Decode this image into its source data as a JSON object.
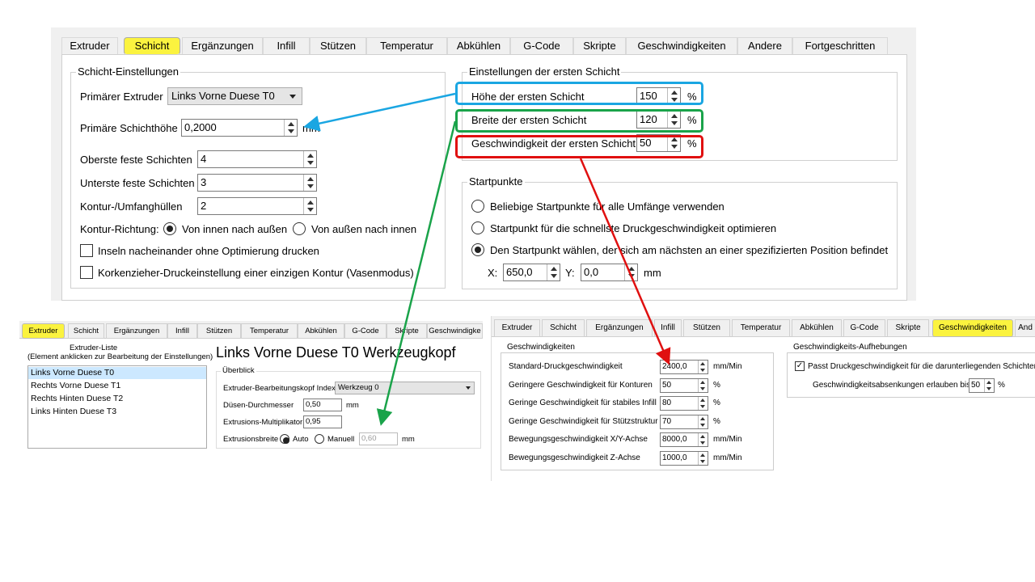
{
  "main": {
    "tabs": [
      "Extruder",
      "Schicht",
      "Ergänzungen",
      "Infill",
      "Stützen",
      "Temperatur",
      "Abkühlen",
      "G-Code",
      "Skripte",
      "Geschwindigkeiten",
      "Andere",
      "Fortgeschritten"
    ],
    "active_tab": "Schicht",
    "layer_settings": {
      "title": "Schicht-Einstellungen",
      "primary_extruder_label": "Primärer Extruder",
      "primary_extruder_value": "Links Vorne Duese T0",
      "layer_height_label": "Primäre Schichthöhe",
      "layer_height_value": "0,2000",
      "layer_height_unit": "mm",
      "top_solid_label": "Oberste feste Schichten",
      "top_solid_value": "4",
      "bottom_solid_label": "Unterste feste Schichten",
      "bottom_solid_value": "3",
      "perimeters_label": "Kontur-/Umfanghüllen",
      "perimeters_value": "2",
      "direction_label": "Kontur-Richtung:",
      "direction_inside_out": "Von innen nach außen",
      "direction_outside_in": "Von außen nach innen",
      "islands_label": "Inseln nacheinander ohne Optimierung drucken",
      "vase_label": "Korkenzieher-Druckeinstellung einer einzigen Kontur (Vasenmodus)"
    },
    "first_layer": {
      "title": "Einstellungen der ersten Schicht",
      "height_label": "Höhe der ersten Schicht",
      "height_value": "150",
      "width_label": "Breite der ersten Schicht",
      "width_value": "120",
      "speed_label": "Geschwindigkeit der ersten Schicht",
      "speed_value": "50",
      "percent": "%"
    },
    "start_points": {
      "title": "Startpunkte",
      "option1": "Beliebige Startpunkte für alle Umfänge verwenden",
      "option2": "Startpunkt für die schnellste Druckgeschwindigkeit optimieren",
      "option3": "Den Startpunkt wählen, der sich am nächsten an einer spezifizierten Position befindet",
      "x_label": "X:",
      "x_value": "650,0",
      "y_label": "Y:",
      "y_value": "0,0",
      "unit": "mm"
    }
  },
  "extruder_panel": {
    "tabs": [
      "Extruder",
      "Schicht",
      "Ergänzungen",
      "Infill",
      "Stützen",
      "Temperatur",
      "Abkühlen",
      "G-Code",
      "Skripte",
      "Geschwindigke"
    ],
    "list_title": "Extruder-Liste",
    "list_hint": "(Element anklicken zur Bearbeitung der Einstellungen)",
    "list_items": [
      "Links Vorne Duese T0",
      "Rechts Vorne Duese T1",
      "Rechts Hinten Duese T2",
      "Links Hinten Duese T3"
    ],
    "heading": "Links Vorne Duese T0 Werkzeugkopf",
    "overview": "Überblick",
    "index_label": "Extruder-Bearbeitungskopf Index",
    "index_value": "Werkzeug 0",
    "nozzle_label": "Düsen-Durchmesser",
    "nozzle_value": "0,50",
    "nozzle_unit": "mm",
    "multiplier_label": "Extrusions-Multiplikator",
    "multiplier_value": "0,95",
    "width_label": "Extrusionsbreite",
    "width_auto": "Auto",
    "width_manual": "Manuell",
    "width_value": "0,60",
    "width_unit": "mm"
  },
  "speed_panel": {
    "tabs": [
      "Extruder",
      "Schicht",
      "Ergänzungen",
      "Infill",
      "Stützen",
      "Temperatur",
      "Abkühlen",
      "G-Code",
      "Skripte",
      "Geschwindigkeiten",
      "And"
    ],
    "group_title": "Geschwindigkeiten",
    "rows": [
      {
        "label": "Standard-Druckgeschwindigkeit",
        "value": "2400,0",
        "unit": "mm/Min"
      },
      {
        "label": "Geringere Geschwindigkeit für Konturen",
        "value": "50",
        "unit": "%"
      },
      {
        "label": "Geringe Geschwindigkeit für stabiles Infill",
        "value": "80",
        "unit": "%"
      },
      {
        "label": "Geringe Geschwindigkeit für Stützstruktur",
        "value": "70",
        "unit": "%"
      },
      {
        "label": "Bewegungsgeschwindigkeit X/Y-Achse",
        "value": "8000,0",
        "unit": "mm/Min"
      },
      {
        "label": "Bewegungsgeschwindigkeit Z-Achse",
        "value": "1000,0",
        "unit": "mm/Min"
      }
    ],
    "override_title": "Geschwindigkeits-Aufhebungen",
    "override_check": "Passt Druckgeschwindigkeit für die darunterliegenden Schichten",
    "override_reduce_label": "Geschwindigkeitsabsenkungen erlauben bis",
    "override_reduce_value": "50",
    "override_reduce_unit": "%"
  },
  "colors": {
    "highlight_yellow": "#fbf33f",
    "box_blue": "#1aa6e2",
    "box_green": "#1aa34a",
    "box_red": "#e01010",
    "arrow_blue": "#1aa6e2",
    "arrow_green": "#1aa34a",
    "arrow_red": "#e01010"
  }
}
